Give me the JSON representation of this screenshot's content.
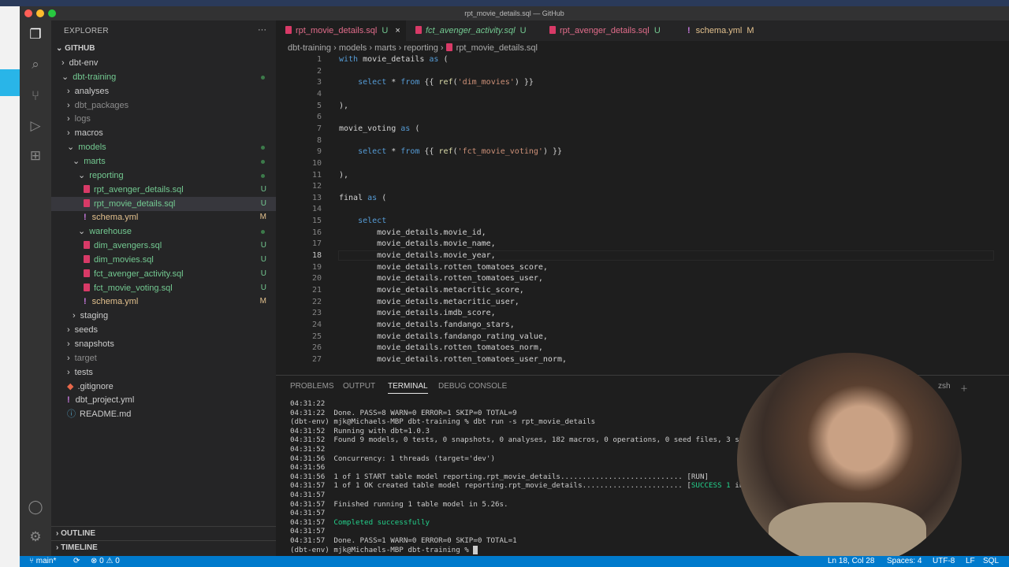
{
  "window_title": "rpt_movie_details.sql — GitHub",
  "explorer": {
    "title": "EXPLORER",
    "more": "···",
    "root": "GITHUB",
    "items": [
      {
        "label": "dbt-env",
        "indent": 1,
        "type": "folder-closed",
        "mark": ""
      },
      {
        "label": "dbt-training",
        "indent": 1,
        "type": "folder-open",
        "mark": "dot",
        "color": "#73c991"
      },
      {
        "label": "analyses",
        "indent": 2,
        "type": "folder-closed",
        "mark": ""
      },
      {
        "label": "dbt_packages",
        "indent": 2,
        "type": "folder-closed",
        "mark": "",
        "color": "#8c8c8c"
      },
      {
        "label": "logs",
        "indent": 2,
        "type": "folder-closed",
        "mark": "",
        "color": "#8c8c8c"
      },
      {
        "label": "macros",
        "indent": 2,
        "type": "folder-closed",
        "mark": ""
      },
      {
        "label": "models",
        "indent": 2,
        "type": "folder-open",
        "mark": "dot",
        "color": "#73c991"
      },
      {
        "label": "marts",
        "indent": 3,
        "type": "folder-open",
        "mark": "dot",
        "color": "#73c991"
      },
      {
        "label": "reporting",
        "indent": 4,
        "type": "folder-open",
        "mark": "dot",
        "color": "#73c991"
      },
      {
        "label": "rpt_avenger_details.sql",
        "indent": 5,
        "type": "sql",
        "mark": "U",
        "color": "#73c991"
      },
      {
        "label": "rpt_movie_details.sql",
        "indent": 5,
        "type": "sql",
        "mark": "U",
        "color": "#73c991",
        "selected": true
      },
      {
        "label": "schema.yml",
        "indent": 5,
        "type": "yml",
        "mark": "M",
        "color": "#e2c08d"
      },
      {
        "label": "warehouse",
        "indent": 4,
        "type": "folder-open",
        "mark": "dot",
        "color": "#73c991"
      },
      {
        "label": "dim_avengers.sql",
        "indent": 5,
        "type": "sql",
        "mark": "U",
        "color": "#73c991"
      },
      {
        "label": "dim_movies.sql",
        "indent": 5,
        "type": "sql",
        "mark": "U",
        "color": "#73c991"
      },
      {
        "label": "fct_avenger_activity.sql",
        "indent": 5,
        "type": "sql",
        "mark": "U",
        "color": "#73c991"
      },
      {
        "label": "fct_movie_voting.sql",
        "indent": 5,
        "type": "sql",
        "mark": "U",
        "color": "#73c991"
      },
      {
        "label": "schema.yml",
        "indent": 5,
        "type": "yml",
        "mark": "M",
        "color": "#e2c08d"
      },
      {
        "label": "staging",
        "indent": 3,
        "type": "folder-closed",
        "mark": ""
      },
      {
        "label": "seeds",
        "indent": 2,
        "type": "folder-closed",
        "mark": ""
      },
      {
        "label": "snapshots",
        "indent": 2,
        "type": "folder-closed",
        "mark": ""
      },
      {
        "label": "target",
        "indent": 2,
        "type": "folder-closed",
        "mark": "",
        "color": "#8c8c8c"
      },
      {
        "label": "tests",
        "indent": 2,
        "type": "folder-closed",
        "mark": ""
      },
      {
        "label": ".gitignore",
        "indent": 2,
        "type": "git",
        "mark": ""
      },
      {
        "label": "dbt_project.yml",
        "indent": 2,
        "type": "yml",
        "mark": ""
      },
      {
        "label": "README.md",
        "indent": 2,
        "type": "info",
        "mark": ""
      }
    ],
    "outline": "OUTLINE",
    "timeline": "TIMELINE"
  },
  "tabs": [
    {
      "label": "rpt_movie_details.sql",
      "mark": "U",
      "active": true,
      "close": "×"
    },
    {
      "label": "fct_avenger_activity.sql",
      "mark": "U",
      "italic": true
    },
    {
      "label": "rpt_avenger_details.sql",
      "mark": "U"
    },
    {
      "label": "schema.yml",
      "mark": "M",
      "yml": true
    }
  ],
  "breadcrumb": [
    "dbt-training",
    "models",
    "marts",
    "reporting",
    "rpt_movie_details.sql"
  ],
  "code": [
    "with movie_details as (",
    "",
    "    select * from {{ ref('dim_movies') }}",
    "",
    "),",
    "",
    "movie_voting as (",
    "",
    "    select * from {{ ref('fct_movie_voting') }}",
    "",
    "),",
    "",
    "final as (",
    "",
    "    select",
    "        movie_details.movie_id,",
    "        movie_details.movie_name,",
    "        movie_details.movie_year,",
    "        movie_details.rotten_tomatoes_score,",
    "        movie_details.rotten_tomatoes_user,",
    "        movie_details.metacritic_score,",
    "        movie_details.metacritic_user,",
    "        movie_details.imdb_score,",
    "        movie_details.fandango_stars,",
    "        movie_details.fandango_rating_value,",
    "        movie_details.rotten_tomatoes_norm,",
    "        movie_details.rotten_tomatoes_user_norm,"
  ],
  "current_line": 18,
  "panel": {
    "tabs": [
      "PROBLEMS",
      "OUTPUT",
      "TERMINAL",
      "DEBUG CONSOLE"
    ],
    "active": "TERMINAL",
    "shell": "zsh"
  },
  "terminal": [
    "04:31:22",
    "04:31:22  Done. PASS=8 WARN=0 ERROR=1 SKIP=0 TOTAL=9",
    "(dbt-env) mjk@Michaels-MBP dbt-training % dbt run -s rpt_movie_details",
    "04:31:52  Running with dbt=1.0.3",
    "04:31:52  Found 9 models, 0 tests, 0 snapshots, 0 analyses, 182 macros, 0 operations, 0 seed files, 3 sou",
    "04:31:52",
    "04:31:56  Concurrency: 1 threads (target='dev')",
    "04:31:56",
    "04:31:56  1 of 1 START table model reporting.rpt_movie_details............................ [RUN]",
    "04:31:57  1 of 1 OK created table model reporting.rpt_movie_details....................... [SUCCESS 1 in ...",
    "04:31:57",
    "04:31:57  Finished running 1 table model in 5.26s.",
    "04:31:57",
    "04:31:57  Completed successfully",
    "04:31:57",
    "04:31:57  Done. PASS=1 WARN=0 ERROR=0 SKIP=0 TOTAL=1",
    "(dbt-env) mjk@Michaels-MBP dbt-training % "
  ],
  "status": {
    "branch": "main*",
    "errors": "0",
    "warnings": "0",
    "position": "Ln 18, Col 28",
    "spaces": "Spaces: 4",
    "encoding": "UTF-8",
    "eol": "LF",
    "language": "SQL"
  }
}
